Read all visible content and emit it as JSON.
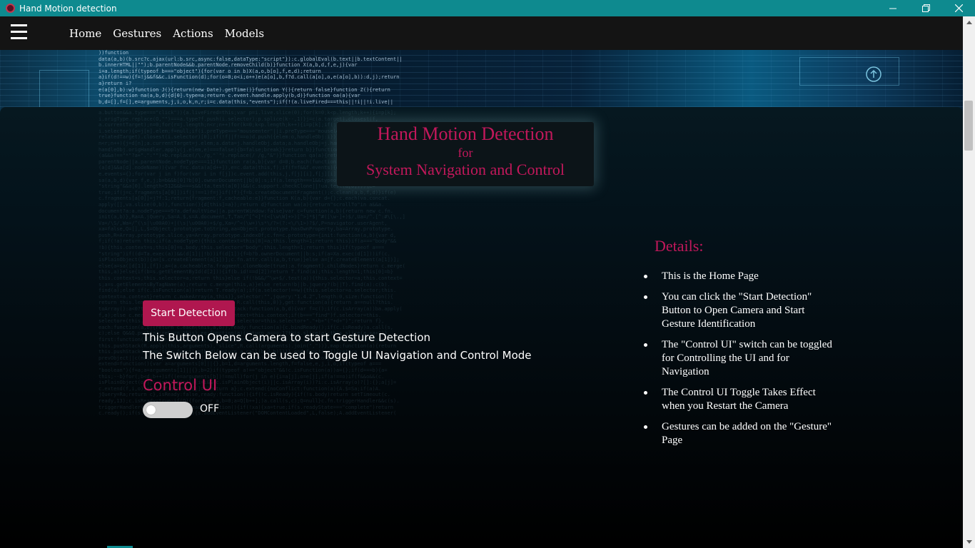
{
  "window": {
    "title": "Hand Motion detection",
    "app_icon": "app-logo-icon",
    "controls": [
      "minimize-icon",
      "restore-icon",
      "close-icon"
    ],
    "titlebar_color": "#0e8a8f"
  },
  "nav": {
    "menu_icon": "hamburger-menu-icon",
    "links": [
      "Home",
      "Gestures",
      "Actions",
      "Models"
    ]
  },
  "hero": {
    "title": "Hand Motion Detection",
    "connector": "for",
    "subtitle": "System Navigation and Control"
  },
  "controls": {
    "start_button": "Start Detection",
    "description_1": "This Button Opens Camera to start Gesture Detection",
    "description_2": "The Switch Below can be used to Toggle UI Navigation and Control Mode",
    "control_heading": "Control UI",
    "toggle_state": "OFF",
    "toggle_on": false
  },
  "details": {
    "heading": "Details:",
    "items": [
      "This is the Home Page",
      "You can click the \"Start Detection\" Button to Open Camera and Start Gesture Identification",
      "The \"Control UI\" switch can be toggled for Controlling the UI and for Navigation",
      "The Control UI Toggle Takes Effect when you Restart the Camera",
      "Gestures can be added on the \"Gesture\" Page"
    ]
  },
  "colors": {
    "accent": "#c2185b",
    "button": "#b0174f",
    "navbar": "#141414"
  }
}
